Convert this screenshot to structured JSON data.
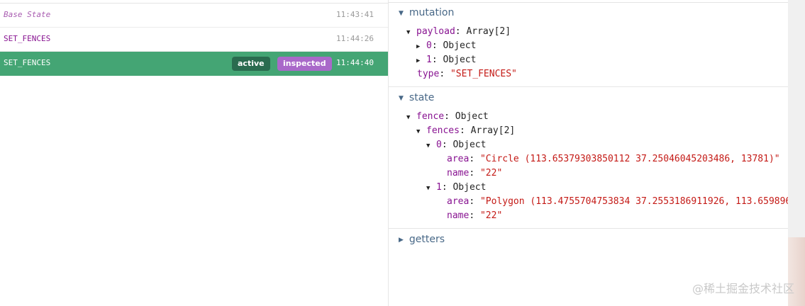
{
  "history": {
    "entries": [
      {
        "name": "Base State",
        "time": "11:43:41"
      },
      {
        "name": "SET_FENCES",
        "time": "11:44:26"
      },
      {
        "name": "SET_FENCES",
        "time": "11:44:40",
        "tags": [
          "active",
          "inspected"
        ]
      }
    ]
  },
  "inspector": {
    "mutation": {
      "title": "mutation",
      "payload_key": "payload",
      "payload_type": "Array[2]",
      "items": [
        {
          "key": "0",
          "type": "Object"
        },
        {
          "key": "1",
          "type": "Object"
        }
      ],
      "type_key": "type",
      "type_value": "\"SET_FENCES\""
    },
    "state": {
      "title": "state",
      "fence_key": "fence",
      "fence_type": "Object",
      "fences_key": "fences",
      "fences_type": "Array[2]",
      "items": [
        {
          "key": "0",
          "type": "Object",
          "area_key": "area",
          "area": "\"Circle (113.65379303850112 37.25046045203486, 13781)\"",
          "name_key": "name",
          "name": "\"22\""
        },
        {
          "key": "1",
          "type": "Object",
          "area_key": "area",
          "area": "\"Polygon (113.4755704753834 37.2553186911926, 113.6598965",
          "name_key": "name",
          "name": "\"22\""
        }
      ]
    },
    "getters": {
      "title": "getters"
    }
  },
  "watermark": "@稀土掘金技术社区",
  "colors": {
    "selected_row": "#44a574",
    "active_tag": "#2a6b4f",
    "inspected_tag": "#a969c9",
    "key_purple": "#881391",
    "string_red": "#c41a16",
    "section_title": "#486887"
  }
}
